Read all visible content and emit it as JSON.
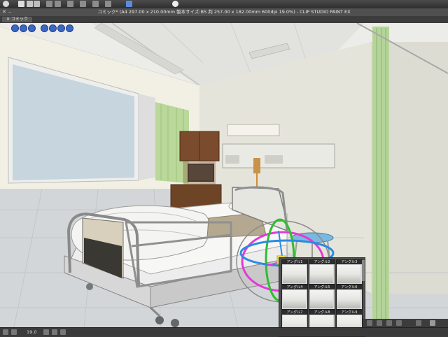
{
  "app": {
    "title": "コミック* (A4 297.00 x 210.00mm 製本サイズ:B5 判 257.00 x 182.00mm 600dpi 19.0%) - CLIP STUDIO PAINT EX",
    "close_glyph": "✕",
    "minimize_glyph": "–"
  },
  "toolbar": {
    "icons": [
      "eye-icon",
      "new-icon",
      "open-icon",
      "save-icon",
      "undo-icon",
      "redo-icon",
      "transform-icon",
      "select-icon",
      "clear-icon",
      "fill-icon",
      "pen-icon",
      "help-icon"
    ]
  },
  "tab": {
    "label": "コミック"
  },
  "camera_toolbar": {
    "icons": [
      "camera-rotate-icon",
      "camera-pan-icon",
      "camera-dolly-icon",
      "object-move-icon",
      "object-rotate-icon",
      "object-scale-icon",
      "perspective-icon"
    ]
  },
  "angle_panel": {
    "items": [
      {
        "label": "アングル1"
      },
      {
        "label": "アングル2"
      },
      {
        "label": "アングル3"
      },
      {
        "label": "アングル4"
      },
      {
        "label": "アングル5"
      },
      {
        "label": "アングル6"
      },
      {
        "label": "アングル7"
      },
      {
        "label": "アングル8"
      },
      {
        "label": "アングル9"
      }
    ]
  },
  "status": {
    "zoom": "19.0"
  },
  "colors": {
    "wall": "#e8e8e0",
    "curtain": "#b7d89a",
    "window": "#c8d8e4",
    "cabinet": "#7a4b2c",
    "floor": "#d4d6d8",
    "gizmo_x": "#e13ad6",
    "gizmo_y": "#2fbe2f",
    "gizmo_z": "#2a8ce0"
  }
}
